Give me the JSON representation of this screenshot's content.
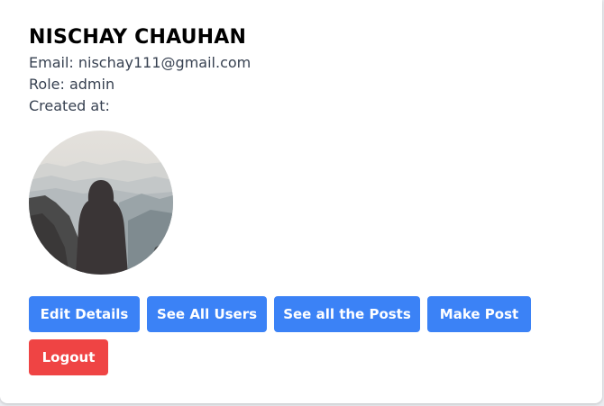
{
  "profile": {
    "name": "NISCHAY CHAUHAN",
    "email_line": "Email: nischay111@gmail.com",
    "role_line": "Role: admin",
    "created_line": "Created at:"
  },
  "avatar": {
    "icon": "hooded-figure-mountains-photo"
  },
  "actions": {
    "edit_details": "Edit Details",
    "see_all_users": "See All Users",
    "see_all_posts": "See all the Posts",
    "make_post": "Make Post",
    "logout": "Logout"
  },
  "colors": {
    "primary_button": "#3b82f6",
    "danger_button": "#ef4444",
    "text": "#374151",
    "heading": "#000000"
  }
}
